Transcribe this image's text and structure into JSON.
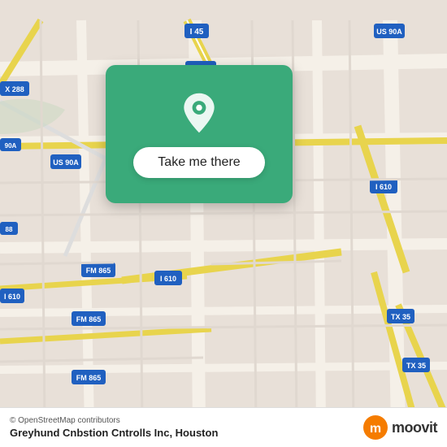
{
  "map": {
    "background_color": "#e8e0d8",
    "center": {
      "lat": 29.76,
      "lng": -95.38
    }
  },
  "panel": {
    "background_color": "#3aaa7a",
    "button_label": "Take me there",
    "pin_color": "white"
  },
  "bottom_bar": {
    "attribution": "© OpenStreetMap contributors",
    "location_name": "Greyhund Cnbstion Cntrolls Inc, Houston",
    "moovit_label": "moovit"
  }
}
